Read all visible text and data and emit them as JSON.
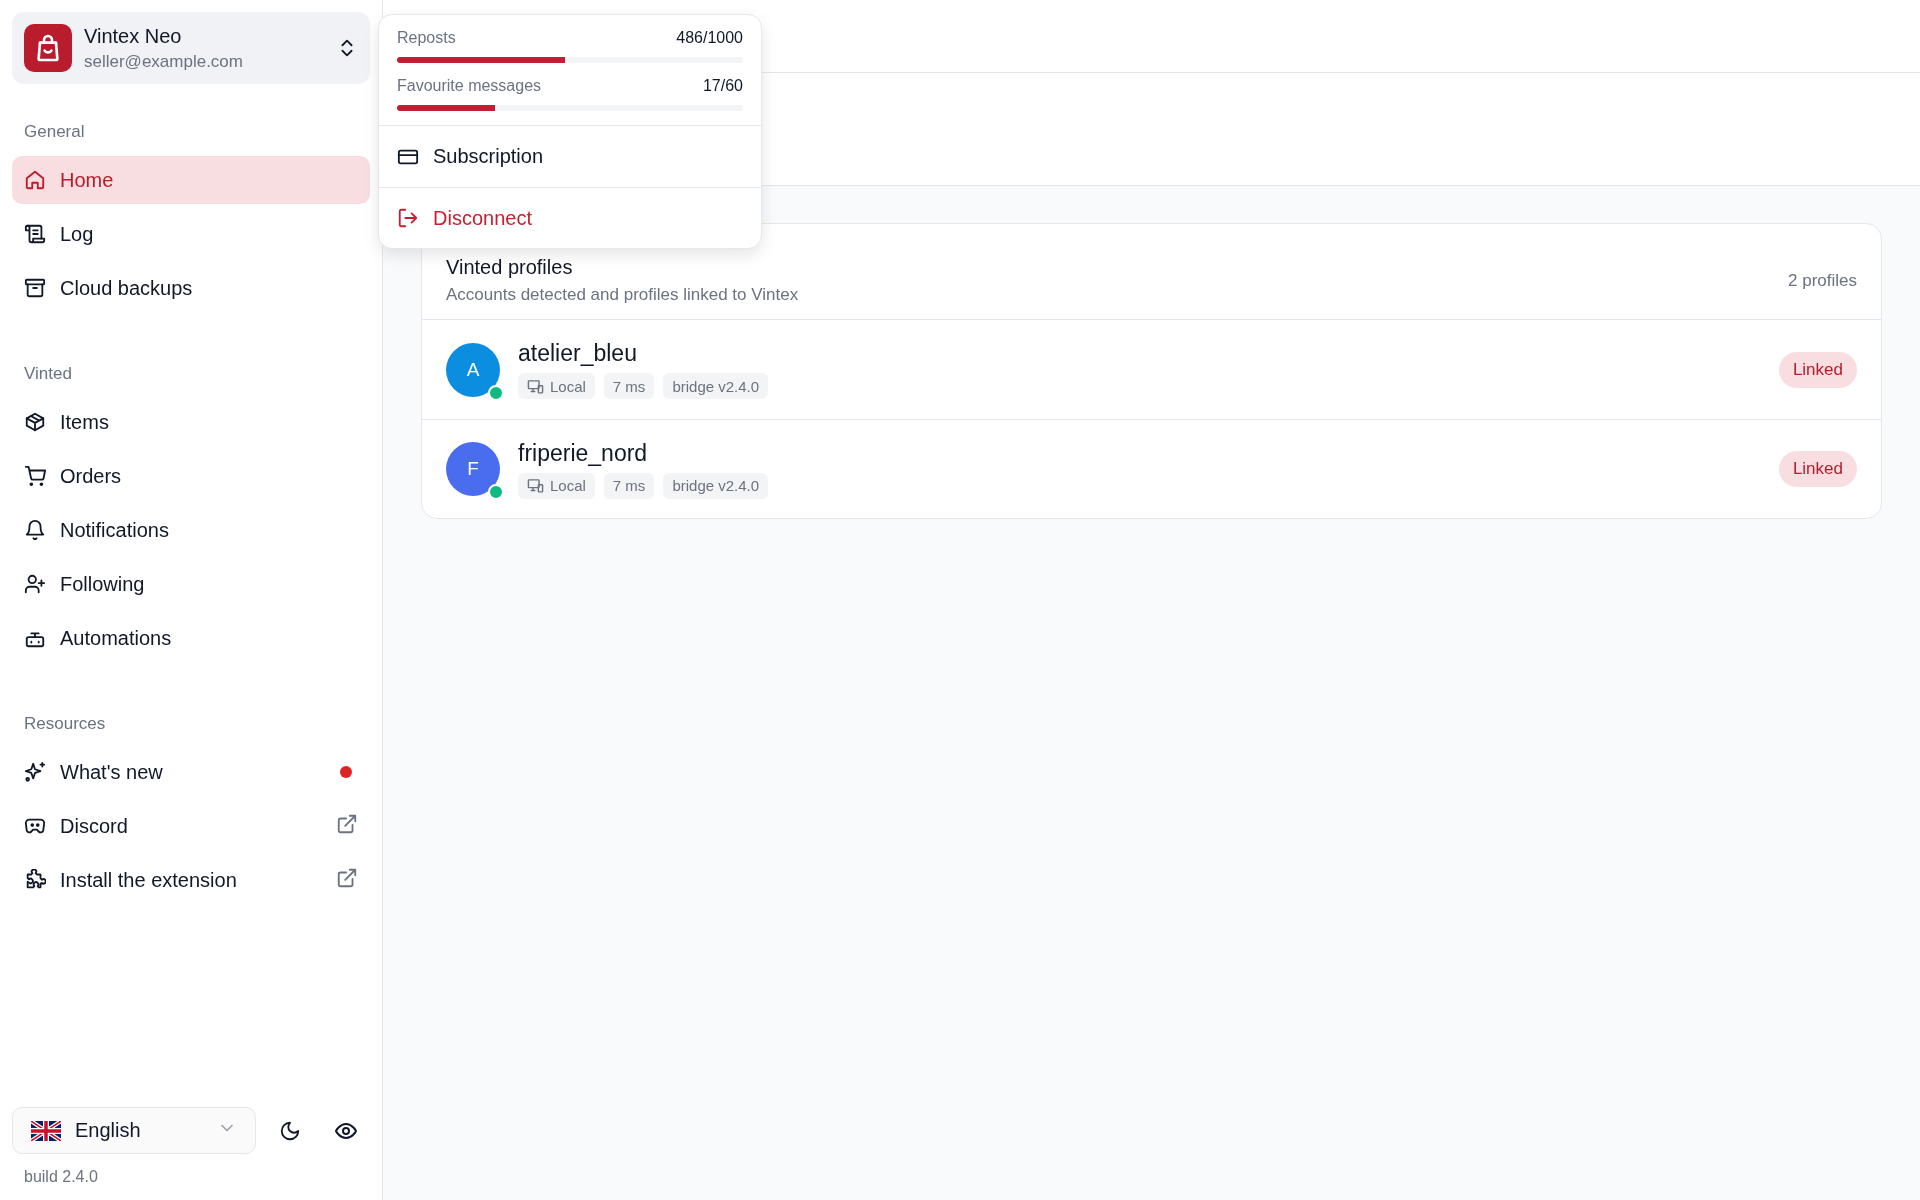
{
  "account": {
    "name": "Vintex Neo",
    "email": "seller@example.com"
  },
  "popup": {
    "quotas": [
      {
        "label": "Reposts",
        "value": "486/1000",
        "level": 0.486
      },
      {
        "label": "Favourite messages",
        "value": "17/60",
        "level": 0.283
      }
    ],
    "items": [
      {
        "kind": "subscription",
        "label": "Subscription"
      },
      {
        "kind": "disconnect",
        "label": "Disconnect"
      }
    ]
  },
  "sidebar": {
    "sections": [
      {
        "title": "General",
        "items": [
          {
            "label": "Home",
            "selected": true,
            "new": false,
            "external": false
          },
          {
            "label": "Log",
            "selected": false,
            "new": false,
            "external": false
          },
          {
            "label": "Cloud backups",
            "selected": false,
            "new": false,
            "external": false
          }
        ]
      },
      {
        "title": "Vinted",
        "items": [
          {
            "label": "Items",
            "selected": false,
            "new": false,
            "external": false
          },
          {
            "label": "Orders",
            "selected": false,
            "new": false,
            "external": false
          },
          {
            "label": "Notifications",
            "selected": false,
            "new": false,
            "external": false
          },
          {
            "label": "Following",
            "selected": false,
            "new": false,
            "external": false
          },
          {
            "label": "Automations",
            "selected": false,
            "new": false,
            "external": false
          }
        ]
      },
      {
        "title": "Resources",
        "items": [
          {
            "label": "What's new",
            "selected": false,
            "new": true,
            "external": false
          },
          {
            "label": "Discord",
            "selected": false,
            "new": false,
            "external": true
          },
          {
            "label": "Install the extension",
            "selected": false,
            "new": false,
            "external": true
          }
        ]
      }
    ],
    "language": "English",
    "build": "build 2.4.0"
  },
  "profiles_card": {
    "title": "Vinted profiles",
    "subtitle": "Accounts detected and profiles linked to Vintex",
    "count": "2 profiles",
    "profiles": [
      {
        "initial": "A",
        "name": "atelier_bleu",
        "color": "#0b8ee0",
        "online": true,
        "tags": [
          {
            "kind": "connection",
            "text": "Local"
          },
          {
            "kind": "plain",
            "text": "7 ms"
          },
          {
            "kind": "plain",
            "text": "bridge v2.4.0"
          }
        ],
        "status": "Linked"
      },
      {
        "initial": "F",
        "name": "friperie_nord",
        "color": "#4a6df0",
        "online": true,
        "tags": [
          {
            "kind": "connection",
            "text": "Local"
          },
          {
            "kind": "plain",
            "text": "7 ms"
          },
          {
            "kind": "plain",
            "text": "bridge v2.4.0"
          }
        ],
        "status": "Linked"
      }
    ]
  }
}
